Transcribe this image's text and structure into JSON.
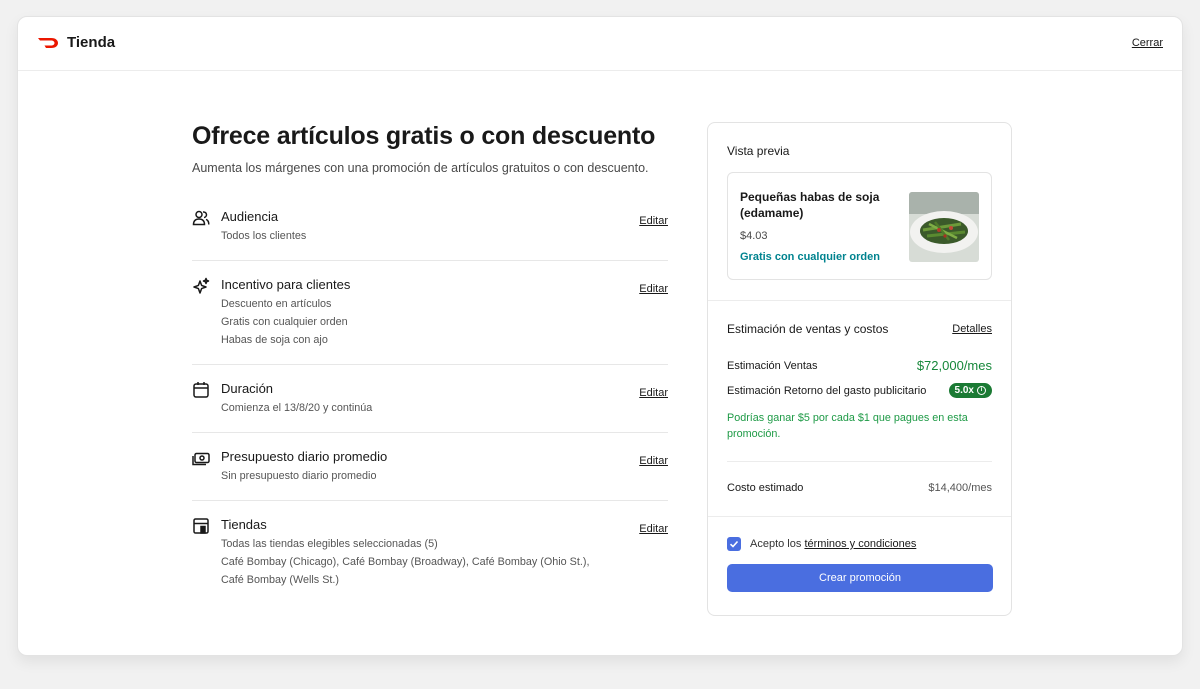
{
  "colors": {
    "brand_red": "#eb1700",
    "accent_blue": "#4a6ee0",
    "positive_green": "#16873a",
    "promo_teal": "#00838f"
  },
  "header": {
    "brand": "Tienda",
    "brand_icon": "doordash-logo-icon",
    "close": "Cerrar"
  },
  "page": {
    "title": "Ofrece artículos gratis o con descuento",
    "subtitle": "Aumenta los márgenes con una promoción de artículos gratuitos o con descuento."
  },
  "sections": [
    {
      "icon": "people-icon",
      "title": "Audiencia",
      "lines": [
        "Todos los clientes"
      ],
      "edit": "Editar"
    },
    {
      "icon": "sparkle-icon",
      "title": "Incentivo para clientes",
      "lines": [
        "Descuento en artículos",
        "Gratis con cualquier orden",
        "Habas de soja con ajo"
      ],
      "edit": "Editar"
    },
    {
      "icon": "calendar-icon",
      "title": "Duración",
      "lines": [
        "Comienza el 13/8/20 y continúa"
      ],
      "edit": "Editar"
    },
    {
      "icon": "money-icon",
      "title": "Presupuesto diario promedio",
      "lines": [
        "Sin presupuesto diario promedio"
      ],
      "edit": "Editar"
    },
    {
      "icon": "store-icon",
      "title": "Tiendas",
      "lines": [
        "Todas las tiendas elegibles seleccionadas (5)",
        "Café Bombay (Chicago), Café Bombay (Broadway), Café Bombay (Ohio St.),",
        "Café Bombay (Wells St.)"
      ],
      "edit": "Editar"
    }
  ],
  "preview": {
    "label": "Vista previa",
    "item_name": "Pequeñas habas de soja (edamame)",
    "item_price": "$4.03",
    "item_promo": "Gratis con cualquier orden"
  },
  "estimate": {
    "title": "Estimación de ventas y costos",
    "details": "Detalles",
    "sales_label": "Estimación Ventas",
    "sales_value": "$72,000/mes",
    "roas_label": "Estimación Retorno del gasto publicitario",
    "roas_value": "5.0x",
    "roas_note": "Podrías ganar $5 por cada $1 que pagues en esta promoción.",
    "cost_label": "Costo estimado",
    "cost_value": "$14,400/mes"
  },
  "footer": {
    "terms_prefix": "Acepto los",
    "terms_link": "términos y condiciones",
    "terms_checked": true,
    "create_button": "Crear promoción"
  }
}
